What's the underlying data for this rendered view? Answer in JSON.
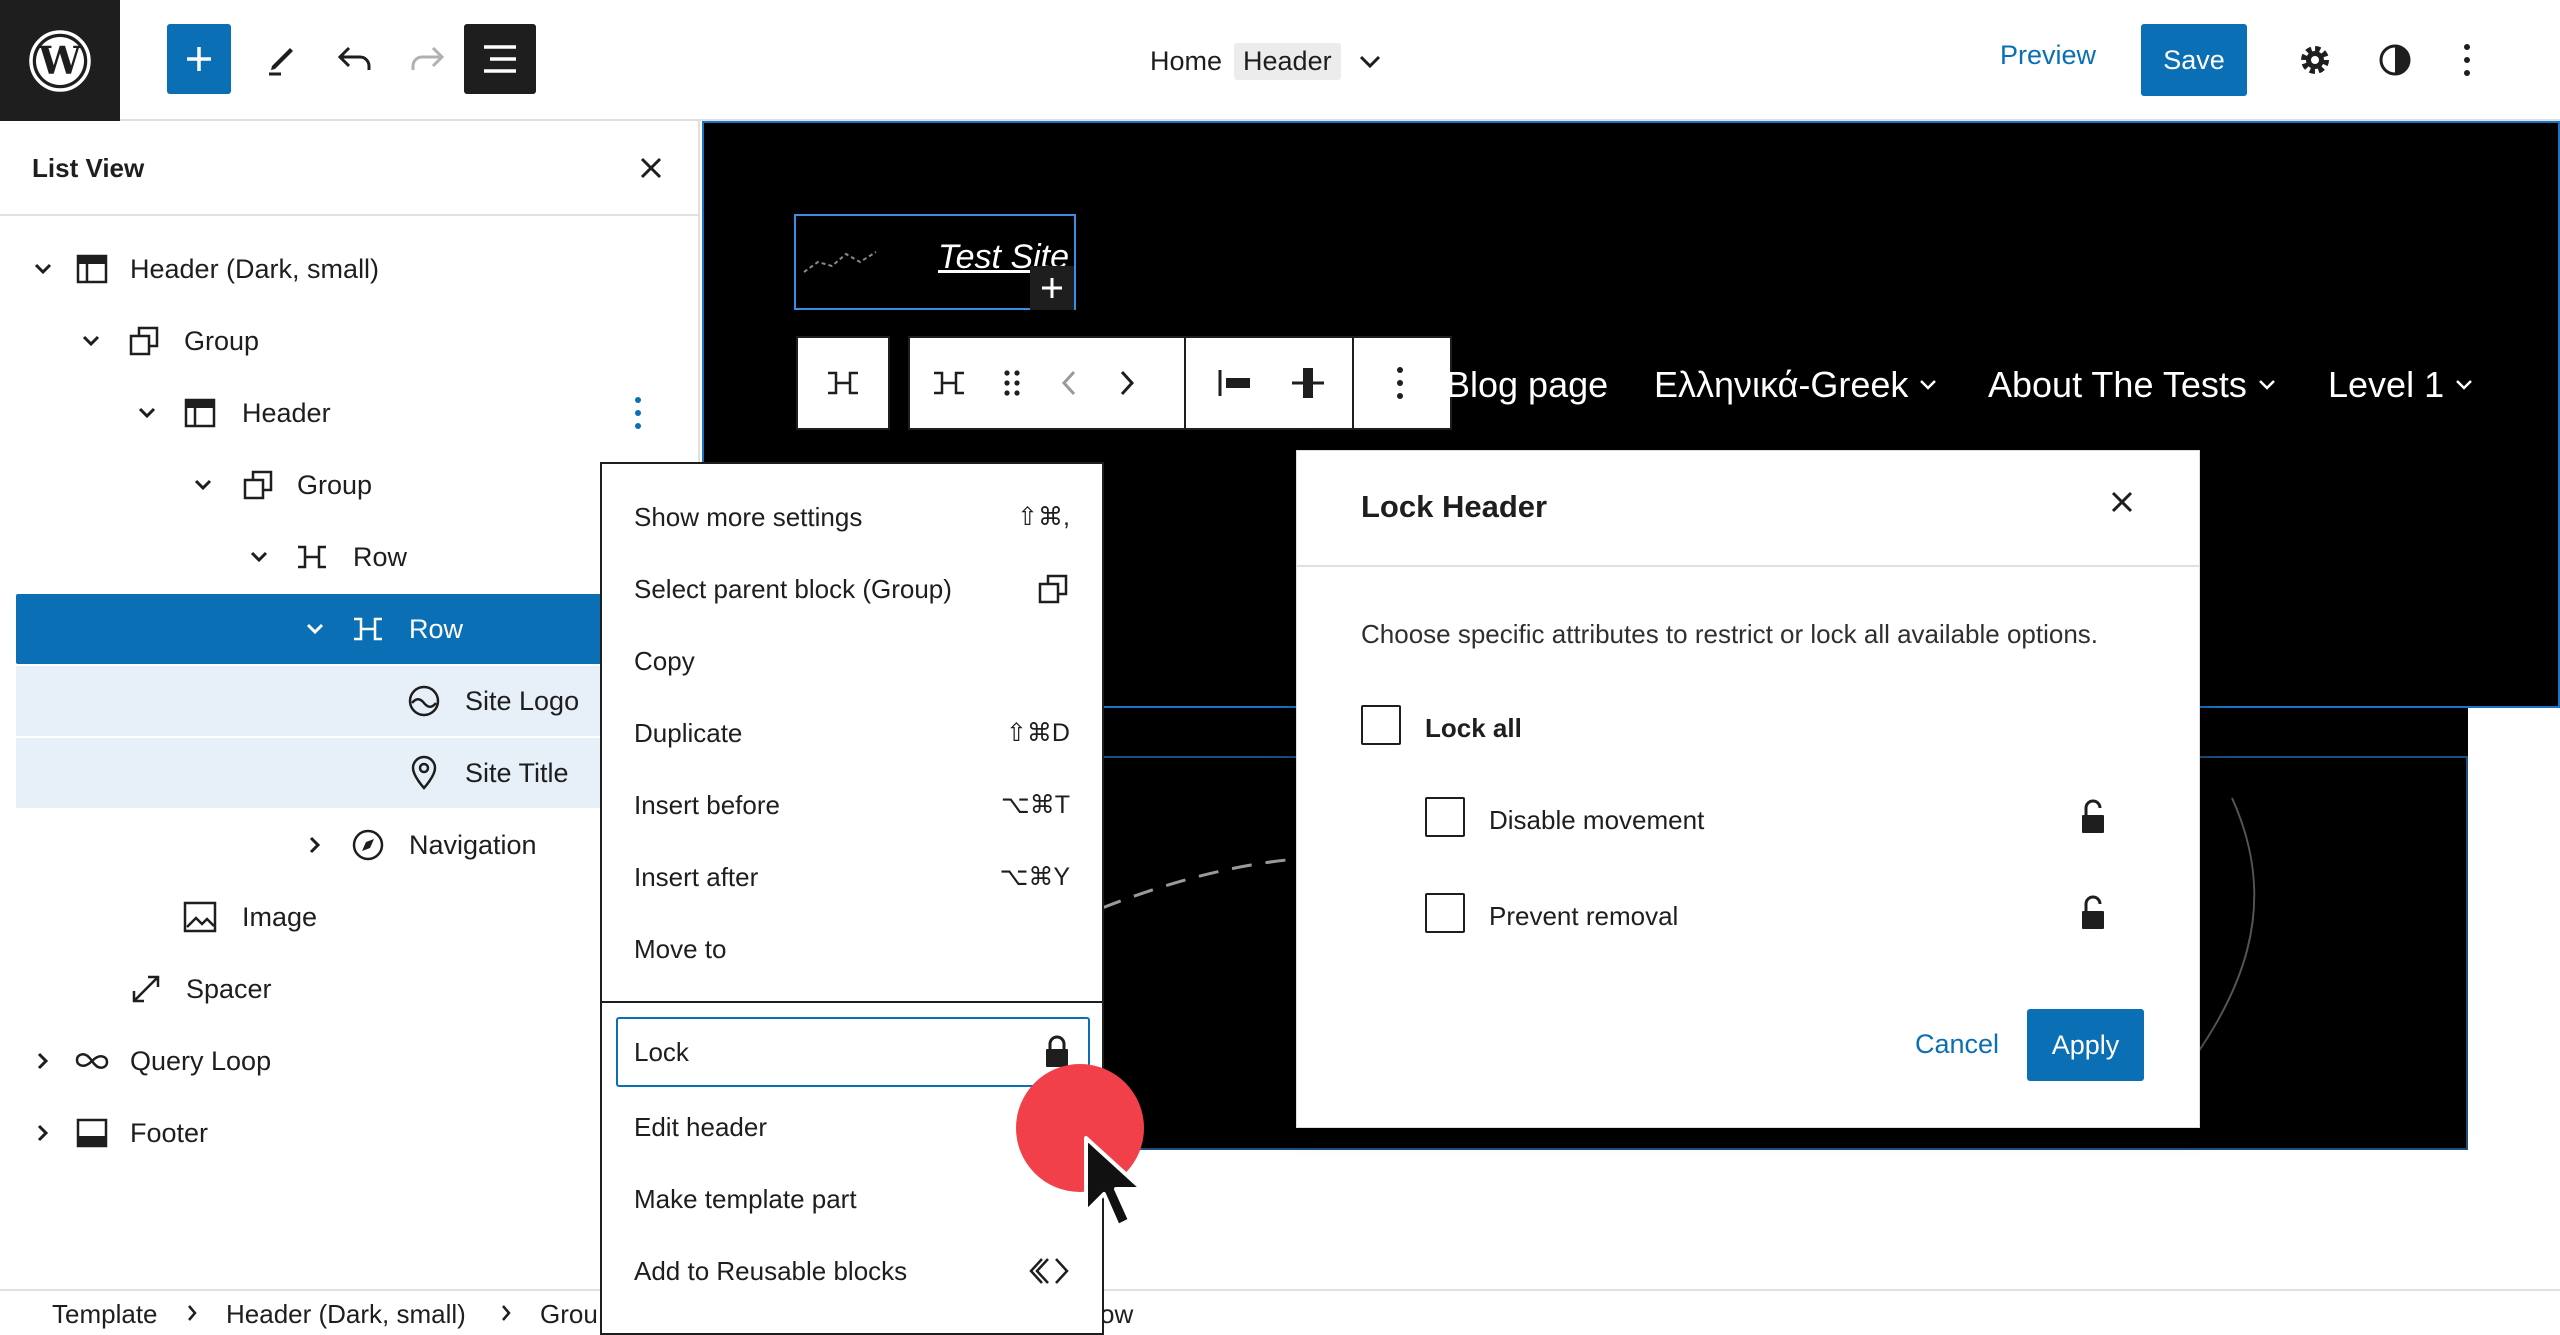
{
  "topbar": {
    "title": "Home",
    "title_badge": "Header",
    "preview_label": "Preview",
    "save_label": "Save"
  },
  "list_view": {
    "title": "List View",
    "items": [
      {
        "label": "Header (Dark, small)",
        "icon": "template-part-icon",
        "expanded": true
      },
      {
        "label": "Group",
        "icon": "group-icon",
        "expanded": true
      },
      {
        "label": "Header",
        "icon": "template-part-icon",
        "expanded": true
      },
      {
        "label": "Group",
        "icon": "group-icon",
        "expanded": true
      },
      {
        "label": "Row",
        "icon": "row-icon",
        "expanded": true
      },
      {
        "label": "Row",
        "icon": "row-icon",
        "expanded": true,
        "selected": true
      },
      {
        "label": "Site Logo",
        "icon": "site-logo-icon"
      },
      {
        "label": "Site Title",
        "icon": "map-marker-icon"
      },
      {
        "label": "Navigation",
        "icon": "compass-icon",
        "expanded": false
      },
      {
        "label": "Image",
        "icon": "image-icon"
      },
      {
        "label": "Spacer",
        "icon": "resize-icon"
      },
      {
        "label": "Query Loop",
        "icon": "loop-icon",
        "expanded": false
      },
      {
        "label": "Footer",
        "icon": "footer-icon",
        "expanded": false
      }
    ]
  },
  "canvas": {
    "site_title": "Test Site",
    "nav_items": [
      "Blog page",
      "Ελληνικά-Greek",
      "About The Tests",
      "Level 1"
    ]
  },
  "context_menu": {
    "items": [
      {
        "label": "Show more settings",
        "shortcut": "⇧⌘,"
      },
      {
        "label": "Select parent block (Group)",
        "icon": "group-icon"
      },
      {
        "label": "Copy"
      },
      {
        "label": "Duplicate",
        "shortcut": "⇧⌘D"
      },
      {
        "label": "Insert before",
        "shortcut": "⌥⌘T"
      },
      {
        "label": "Insert after",
        "shortcut": "⌥⌘Y"
      },
      {
        "label": "Move to"
      },
      {
        "label": "Lock",
        "icon": "lock-icon"
      },
      {
        "label": "Edit header"
      },
      {
        "label": "Make template part"
      },
      {
        "label": "Add to Reusable blocks",
        "icon": "reusable-icon"
      }
    ]
  },
  "breadcrumbs": [
    "Template",
    "Header (Dark, small)",
    "Grou",
    "ow"
  ],
  "lock_modal": {
    "title": "Lock Header",
    "description": "Choose specific attributes to restrict or lock all available options.",
    "lock_all_label": "Lock all",
    "options": [
      {
        "label": "Disable movement",
        "checked": false
      },
      {
        "label": "Prevent removal",
        "checked": false
      }
    ],
    "cancel_label": "Cancel",
    "apply_label": "Apply"
  },
  "colors": {
    "accent": "#0a6fb5",
    "dark": "#1e1e1e",
    "click_indicator": "#f2404a",
    "selected_row_bg": "#0a6fb5",
    "child_row_bg": "#e7f0f8"
  }
}
